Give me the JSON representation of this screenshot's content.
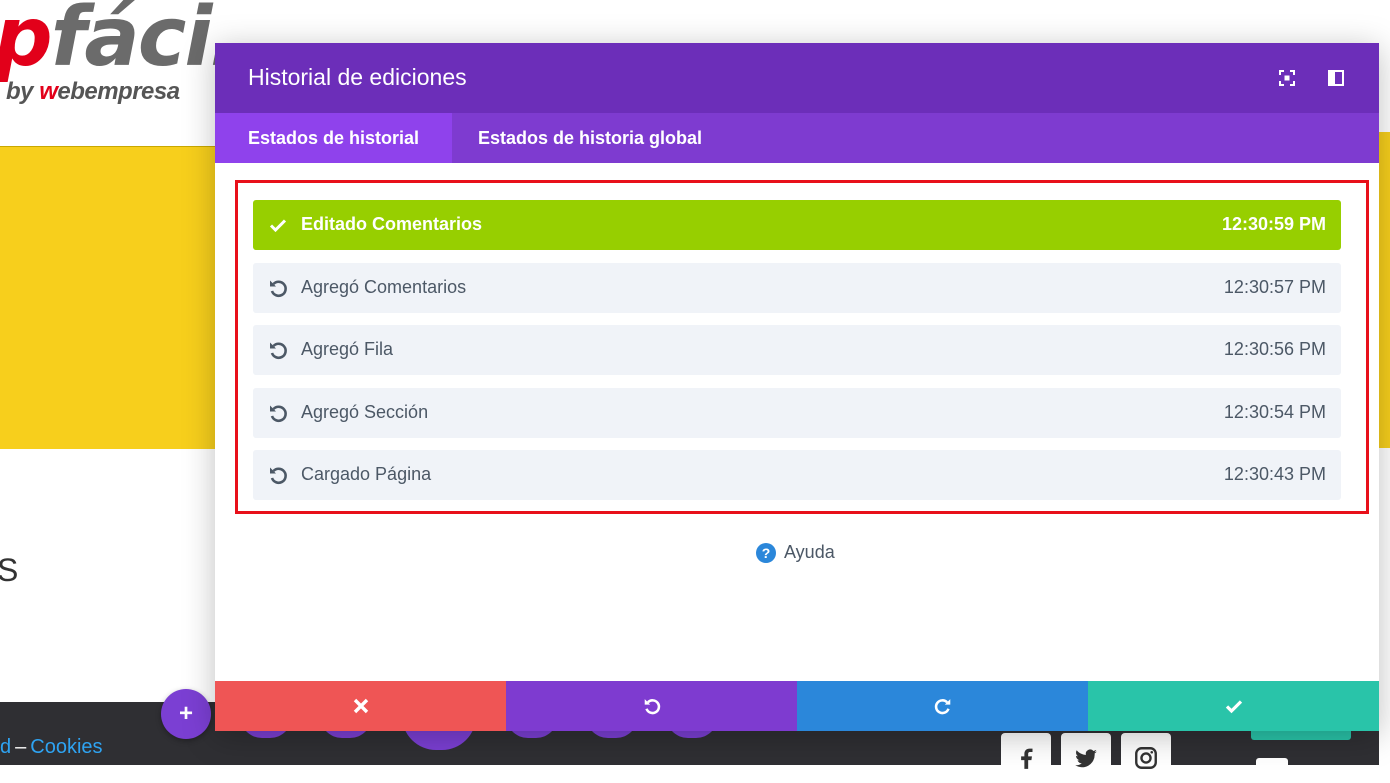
{
  "background": {
    "logo_main": "pfácil",
    "logo_sub": "by webempresa",
    "partial_heading": "S",
    "footer_links": {
      "partial_link": "d",
      "separator": "–",
      "cookies": "Cookies"
    },
    "add_button_label": "+",
    "colors": {
      "yellow": "#f7cf1c",
      "footer": "#2f2f33",
      "link": "#2ea3f2"
    }
  },
  "modal": {
    "title": "Historial de ediciones",
    "header_icons": [
      "fullscreen-icon",
      "sidebar-dock-icon"
    ],
    "tabs": [
      {
        "label": "Estados de historial",
        "active": true
      },
      {
        "label": "Estados de historia global",
        "active": false
      }
    ],
    "history": [
      {
        "label": "Editado Comentarios",
        "time": "12:30:59 PM",
        "icon": "check-icon",
        "active": true
      },
      {
        "label": "Agregó Comentarios",
        "time": "12:30:57 PM",
        "icon": "undo-icon",
        "active": false
      },
      {
        "label": "Agregó Fila",
        "time": "12:30:56 PM",
        "icon": "undo-icon",
        "active": false
      },
      {
        "label": "Agregó Sección",
        "time": "12:30:54 PM",
        "icon": "undo-icon",
        "active": false
      },
      {
        "label": "Cargado Página",
        "time": "12:30:43 PM",
        "icon": "undo-icon",
        "active": false
      }
    ],
    "help": {
      "icon": "?",
      "label": "Ayuda"
    },
    "footer_buttons": [
      {
        "icon": "close-icon",
        "color": "#ef5555"
      },
      {
        "icon": "undo-icon",
        "color": "#7e3bd0"
      },
      {
        "icon": "redo-icon",
        "color": "#2b87da"
      },
      {
        "icon": "check-icon",
        "color": "#29c4a9"
      }
    ],
    "colors": {
      "header": "#6c2eb9",
      "tabs": "#7e3bd0",
      "active_tab": "#8f42ec",
      "active_row": "#97cf00",
      "row": "#f0f3f8",
      "highlight_frame": "#e8101a"
    }
  }
}
